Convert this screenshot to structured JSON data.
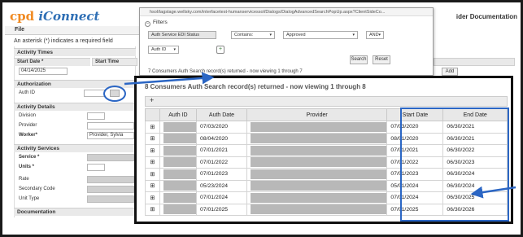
{
  "app": {
    "logo_prefix": "cpd",
    "logo_main": "iConnect",
    "header_right": "ider Documentation",
    "menu_file": "File",
    "required_note": "An asterisk (*) indicates a required field"
  },
  "activity_times": {
    "section": "Activity Times",
    "start_date_label": "Start Date *",
    "start_date_value": "04/14/2025",
    "start_time_label": "Start Time"
  },
  "authorization": {
    "section": "Authorization",
    "auth_id_label": "Auth ID"
  },
  "activity_details": {
    "section": "Activity Details",
    "division_label": "Division",
    "provider_label": "Provider",
    "worker_label": "Worker*",
    "worker_value": "Provider, Sylvia"
  },
  "activity_services": {
    "section": "Activity Services",
    "service_label": "Service *",
    "units_label": "Units *",
    "rate_label": "Rate",
    "secondary_code_label": "Secondary Code",
    "unit_type_label": "Unit Type"
  },
  "documentation": {
    "section": "Documentation"
  },
  "popup": {
    "url": "hsol/tagstage.wellsky.com/interfacetest-humanservicessol/Dialogs/DialogAdvancedSearchPopUp.aspx?ClientSideCo...",
    "filters_title": "Filters",
    "filter_field": "Auth Service EDI Status",
    "filter_operator": "Contains:",
    "filter_value": "Approved",
    "filter_logic": "AND",
    "filter_field2": "Auth ID",
    "search_button": "Search",
    "reset_button": "Reset",
    "result_text": "7 Consumers Auth Search record(s) returned - now viewing 1 through 7",
    "add_button": "Add"
  },
  "zoom": {
    "title": "8 Consumers Auth Search record(s) returned - now viewing 1 through 8",
    "plus": "+",
    "columns": [
      "Auth ID",
      "Auth Date",
      "Provider",
      "Start Date",
      "End Date"
    ],
    "rows": [
      {
        "auth_date": "07/03/2020",
        "start_date": "07/03/2020",
        "end_date": "06/30/2021"
      },
      {
        "auth_date": "08/04/2020",
        "start_date": "08/01/2020",
        "end_date": "06/30/2021"
      },
      {
        "auth_date": "07/01/2021",
        "start_date": "07/01/2021",
        "end_date": "06/30/2022"
      },
      {
        "auth_date": "07/01/2022",
        "start_date": "07/01/2022",
        "end_date": "06/30/2023"
      },
      {
        "auth_date": "07/01/2023",
        "start_date": "07/01/2023",
        "end_date": "06/30/2024"
      },
      {
        "auth_date": "05/23/2024",
        "start_date": "05/01/2024",
        "end_date": "06/30/2024"
      },
      {
        "auth_date": "07/01/2024",
        "start_date": "07/01/2024",
        "end_date": "06/30/2025"
      },
      {
        "auth_date": "07/01/2025",
        "start_date": "07/01/2025",
        "end_date": "06/30/2026"
      }
    ]
  },
  "colors": {
    "highlight_blue": "#2b66c4",
    "frame": "#111111"
  }
}
